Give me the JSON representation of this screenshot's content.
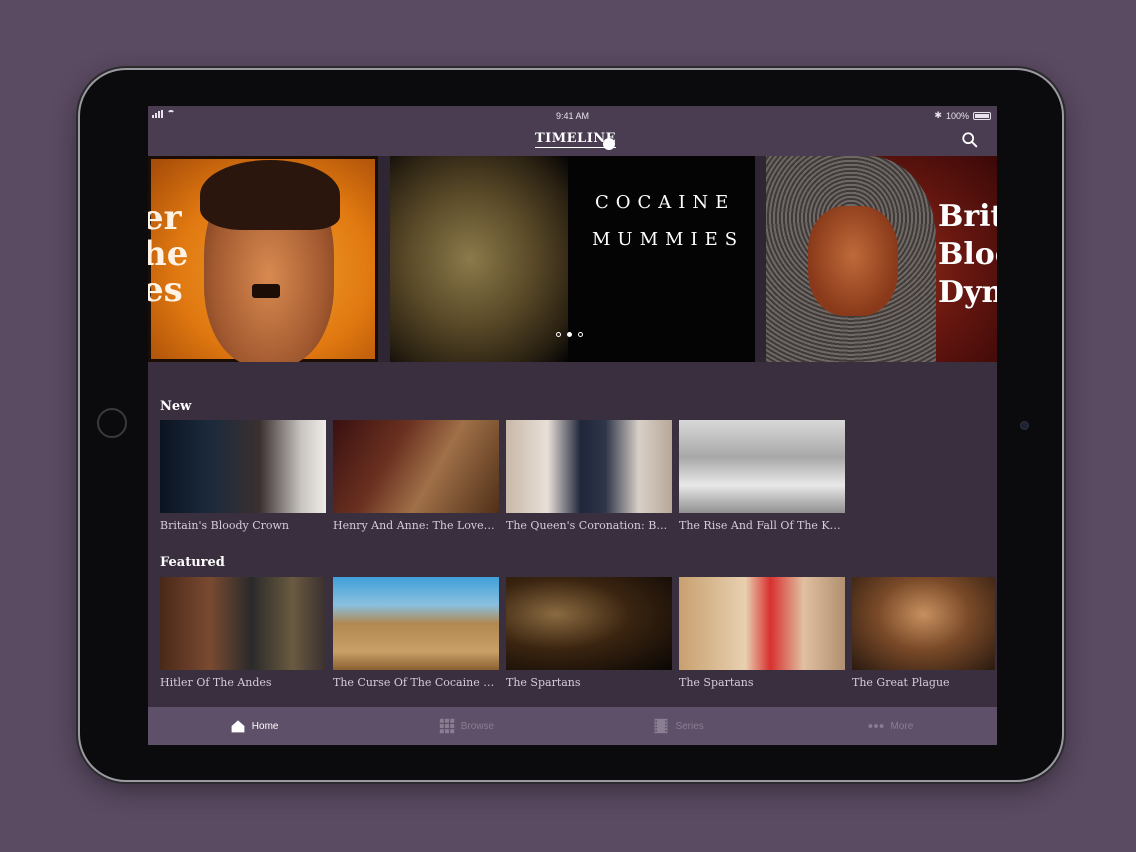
{
  "status": {
    "time": "9:41 AM",
    "battery": "100%"
  },
  "nav": {
    "logo": "TIMELINE"
  },
  "hero": {
    "left_text": "er\nhe\nes",
    "center_title_1": "COCAINE",
    "center_title_2": "MUMMIES",
    "right_text": "Briti\nBloo\nDyn",
    "dots": 3,
    "active_dot": 1
  },
  "sections": {
    "new": {
      "title": "New",
      "items": [
        {
          "label": "Britain's Bloody Crown"
        },
        {
          "label": "Henry And Anne: The Lovers..."
        },
        {
          "label": "The Queen's Coronation: Behi..."
        },
        {
          "label": "The Rise And Fall Of The Kray..."
        }
      ]
    },
    "featured": {
      "title": "Featured",
      "items": [
        {
          "label": "Hitler Of The Andes"
        },
        {
          "label": "The Curse Of The Cocaine Mu..."
        },
        {
          "label": "The Spartans"
        },
        {
          "label": "The Spartans"
        },
        {
          "label": "The Great Plague"
        }
      ]
    }
  },
  "tabs": [
    {
      "label": "Home",
      "icon": "home-icon",
      "active": true
    },
    {
      "label": "Browse",
      "icon": "grid-icon",
      "active": false
    },
    {
      "label": "Series",
      "icon": "film-icon",
      "active": false
    },
    {
      "label": "More",
      "icon": "more-icon",
      "active": false
    }
  ]
}
